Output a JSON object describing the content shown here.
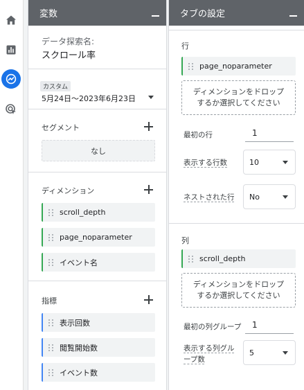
{
  "rail": {
    "items": [
      {
        "icon": "home-icon"
      },
      {
        "icon": "bar-chart-icon"
      },
      {
        "icon": "explore-icon",
        "active": true
      },
      {
        "icon": "advertising-icon"
      }
    ]
  },
  "variables": {
    "title": "変数",
    "exploration_name_label": "データ探索名:",
    "exploration_name": "スクロール率",
    "date_chip": "カスタム",
    "date_range": "5月24日〜2023年6月23日",
    "segments": {
      "label": "セグメント",
      "empty": "なし"
    },
    "dimensions": {
      "label": "ディメンション",
      "items": [
        "scroll_depth",
        "page_noparameter",
        "イベント名"
      ]
    },
    "metrics": {
      "label": "指標",
      "items": [
        "表示回数",
        "閲覧開始数",
        "イベント数"
      ]
    }
  },
  "tab_settings": {
    "title": "タブの設定",
    "rows": {
      "label": "行",
      "chip": "page_noparameter",
      "drop": "ディメンションをドロップ\nするか選択してください",
      "first_row_label": "最初の行",
      "first_row_value": "1",
      "show_rows_label": "表示する行数",
      "show_rows_value": "10",
      "nested_label": "ネストされた行",
      "nested_value": "No"
    },
    "columns": {
      "label": "列",
      "chip": "scroll_depth",
      "drop": "ディメンションをドロップ\nするか選択してください",
      "first_group_label": "最初の列グループ",
      "first_group_value": "1",
      "show_groups_label": "表示する列グループ数",
      "show_groups_value": "5"
    }
  },
  "colors": {
    "header": "#5f6368",
    "dimension_accent": "#34a853",
    "metric_accent": "#4285f4",
    "active_rail": "#1a73e8"
  }
}
